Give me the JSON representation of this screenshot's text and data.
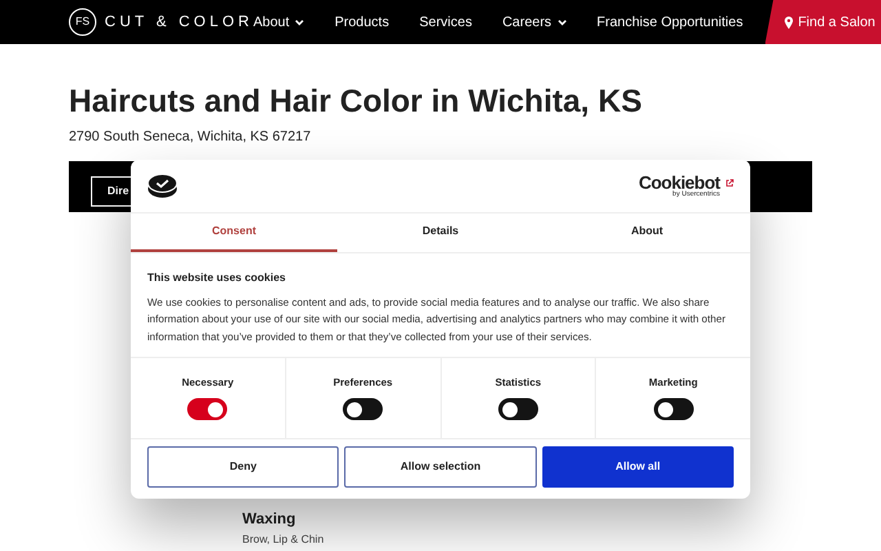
{
  "nav": {
    "logo_mark": "FS",
    "logo_text": "CUT & COLOR",
    "links": [
      {
        "label": "About",
        "dropdown": true
      },
      {
        "label": "Products",
        "dropdown": false
      },
      {
        "label": "Services",
        "dropdown": false
      },
      {
        "label": "Careers",
        "dropdown": true
      },
      {
        "label": "Franchise Opportunities",
        "dropdown": false
      }
    ],
    "cta": "Find a Salon"
  },
  "page": {
    "title": "Haircuts and Hair Color in Wichita, KS",
    "address": "2790 South Seneca, Wichita, KS 67217",
    "bar_button": "Dire",
    "service": {
      "name": "Waxing",
      "detail": "Brow, Lip & Chin"
    }
  },
  "dialog": {
    "brand": "Cookiebot",
    "brand_sub": "by Usercentrics",
    "tabs": [
      {
        "label": "Consent",
        "selected": true
      },
      {
        "label": "Details",
        "selected": false
      },
      {
        "label": "About",
        "selected": false
      }
    ],
    "heading": "This website uses cookies",
    "text": "We use cookies to personalise content and ads, to provide social media features and to analyse our traffic. We also share information about your use of our site with our social media, advertising and analytics partners who may combine it with other information that you’ve provided to them or that they’ve collected from your use of their services.",
    "categories": [
      {
        "label": "Necessary",
        "checked": true
      },
      {
        "label": "Preferences",
        "checked": false
      },
      {
        "label": "Statistics",
        "checked": false
      },
      {
        "label": "Marketing",
        "checked": false
      }
    ],
    "buttons": [
      {
        "label": "Deny",
        "kind": "outline"
      },
      {
        "label": "Allow selection",
        "kind": "outline"
      },
      {
        "label": "Allow all",
        "kind": "primary"
      }
    ]
  }
}
